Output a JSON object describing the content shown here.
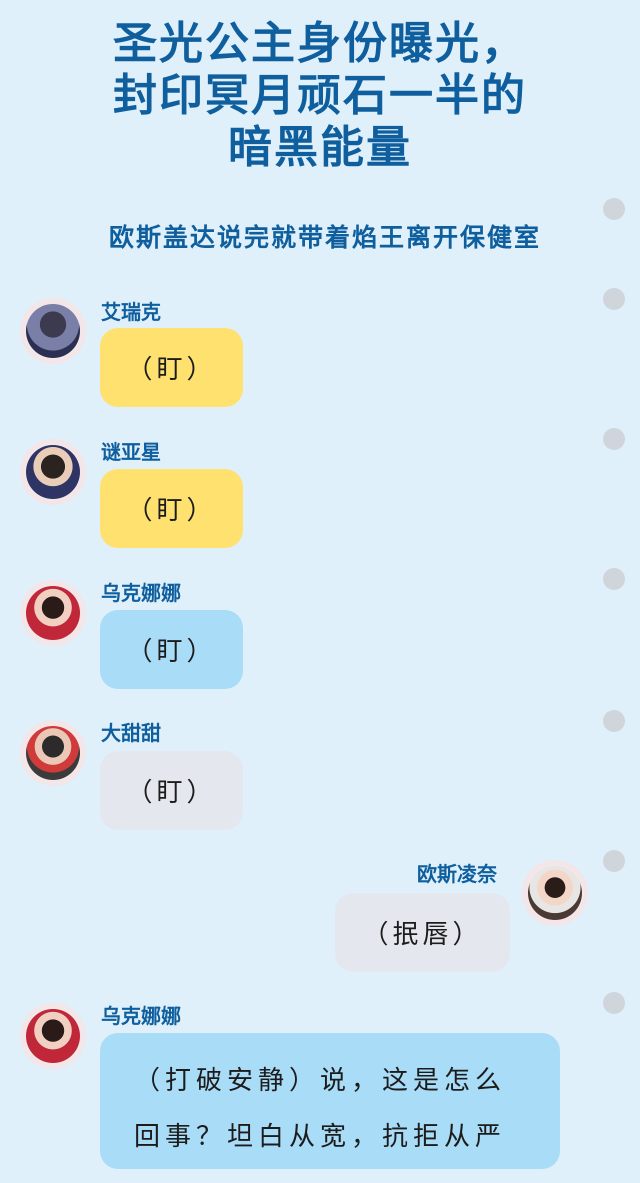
{
  "title_lines": [
    "圣光公主身份曝光，",
    "封印冥月顽石一半的",
    "暗黑能量"
  ],
  "subtitle": "欧斯盖达说完就带着焰王离开保健室",
  "messages": [
    {
      "name": "艾瑞克",
      "text": "（盯）"
    },
    {
      "name": "谜亚星",
      "text": "（盯）"
    },
    {
      "name": "乌克娜娜",
      "text": "（盯）"
    },
    {
      "name": "大甜甜",
      "text": "（盯）"
    },
    {
      "name": "欧斯凌奈",
      "text": "（抿唇）"
    },
    {
      "name": "乌克娜娜",
      "text": "（打破安静）说，这是怎么回事？坦白从宽，抗拒从严"
    }
  ],
  "colors": {
    "background": "#dff0fb",
    "title": "#0f5f9e",
    "bubble_yellow": "#ffe170",
    "bubble_blue": "#a9dcf7",
    "bubble_gray": "#e4e8ee"
  }
}
